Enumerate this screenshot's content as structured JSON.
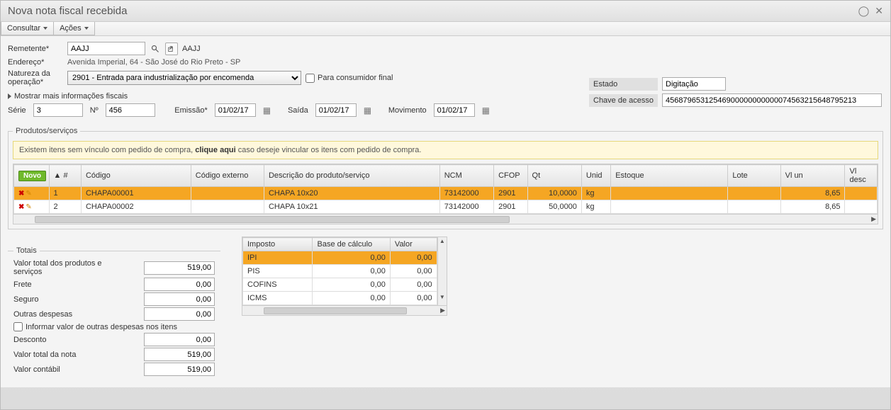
{
  "window": {
    "title": "Nova nota fiscal recebida"
  },
  "menus": {
    "consultar": "Consultar",
    "acoes": "Ações"
  },
  "form": {
    "remetente_label": "Remetente",
    "remetente_value": "AAJJ",
    "remetente_display": "AAJJ",
    "endereco_label": "Endereço",
    "endereco_value": "Avenida Imperial, 64 - São José do Rio Preto - SP",
    "natureza_label": "Natureza da operação",
    "natureza_value": "2901 - Entrada para industrialização por encomenda",
    "consumidor_label": "Para consumidor final",
    "mais_info": "Mostrar mais informações fiscais",
    "serie_label": "Série",
    "serie_value": "3",
    "numero_label": "Nº",
    "numero_value": "456",
    "emissao_label": "Emissão",
    "emissao_value": "01/02/17",
    "saida_label": "Saída",
    "saida_value": "01/02/17",
    "movimento_label": "Movimento",
    "movimento_value": "01/02/17"
  },
  "right": {
    "estado_label": "Estado",
    "estado_value": "Digitação",
    "chave_label": "Chave de acesso",
    "chave_value": "45687965312546900000000000074563215648795213"
  },
  "produtos": {
    "legend": "Produtos/serviços",
    "notice_pre": "Existem itens sem vínculo com pedido de compra, ",
    "notice_bold": "clique aqui",
    "notice_post": " caso deseje vincular os itens com pedido de compra.",
    "novo": "Novo",
    "headers": {
      "num": "#",
      "codigo": "Código",
      "cod_ext": "Código externo",
      "descricao": "Descrição do produto/serviço",
      "ncm": "NCM",
      "cfop": "CFOP",
      "qt": "Qt",
      "unid": "Unid",
      "estoque": "Estoque",
      "lote": "Lote",
      "vlun": "Vl un",
      "vldesc": "Vl desc"
    },
    "rows": [
      {
        "n": "1",
        "codigo": "CHAPA00001",
        "cod_ext": "",
        "desc": "CHAPA 10x20",
        "ncm": "73142000",
        "cfop": "2901",
        "qt": "10,0000",
        "unid": "kg",
        "estoque": "",
        "lote": "",
        "vlun": "8,65",
        "vldesc": "",
        "selected": true
      },
      {
        "n": "2",
        "codigo": "CHAPA00002",
        "cod_ext": "",
        "desc": "CHAPA 10x21",
        "ncm": "73142000",
        "cfop": "2901",
        "qt": "50,0000",
        "unid": "kg",
        "estoque": "",
        "lote": "",
        "vlun": "8,65",
        "vldesc": "",
        "selected": false
      }
    ]
  },
  "totais": {
    "legend": "Totais",
    "valor_total_label": "Valor total dos produtos e serviços",
    "valor_total": "519,00",
    "frete_label": "Frete",
    "frete": "0,00",
    "seguro_label": "Seguro",
    "seguro": "0,00",
    "outras_label": "Outras despesas",
    "outras": "0,00",
    "informar_label": "Informar valor de outras despesas nos itens",
    "desconto_label": "Desconto",
    "desconto": "0,00",
    "valor_nota_label": "Valor total da nota",
    "valor_nota": "519,00",
    "valor_contabil_label": "Valor contábil",
    "valor_contabil": "519,00"
  },
  "impostos": {
    "headers": {
      "imposto": "Imposto",
      "base": "Base de cálculo",
      "valor": "Valor"
    },
    "rows": [
      {
        "imposto": "IPI",
        "base": "0,00",
        "valor": "0,00",
        "selected": true
      },
      {
        "imposto": "PIS",
        "base": "0,00",
        "valor": "0,00",
        "selected": false
      },
      {
        "imposto": "COFINS",
        "base": "0,00",
        "valor": "0,00",
        "selected": false
      },
      {
        "imposto": "ICMS",
        "base": "0,00",
        "valor": "0,00",
        "selected": false
      }
    ]
  }
}
